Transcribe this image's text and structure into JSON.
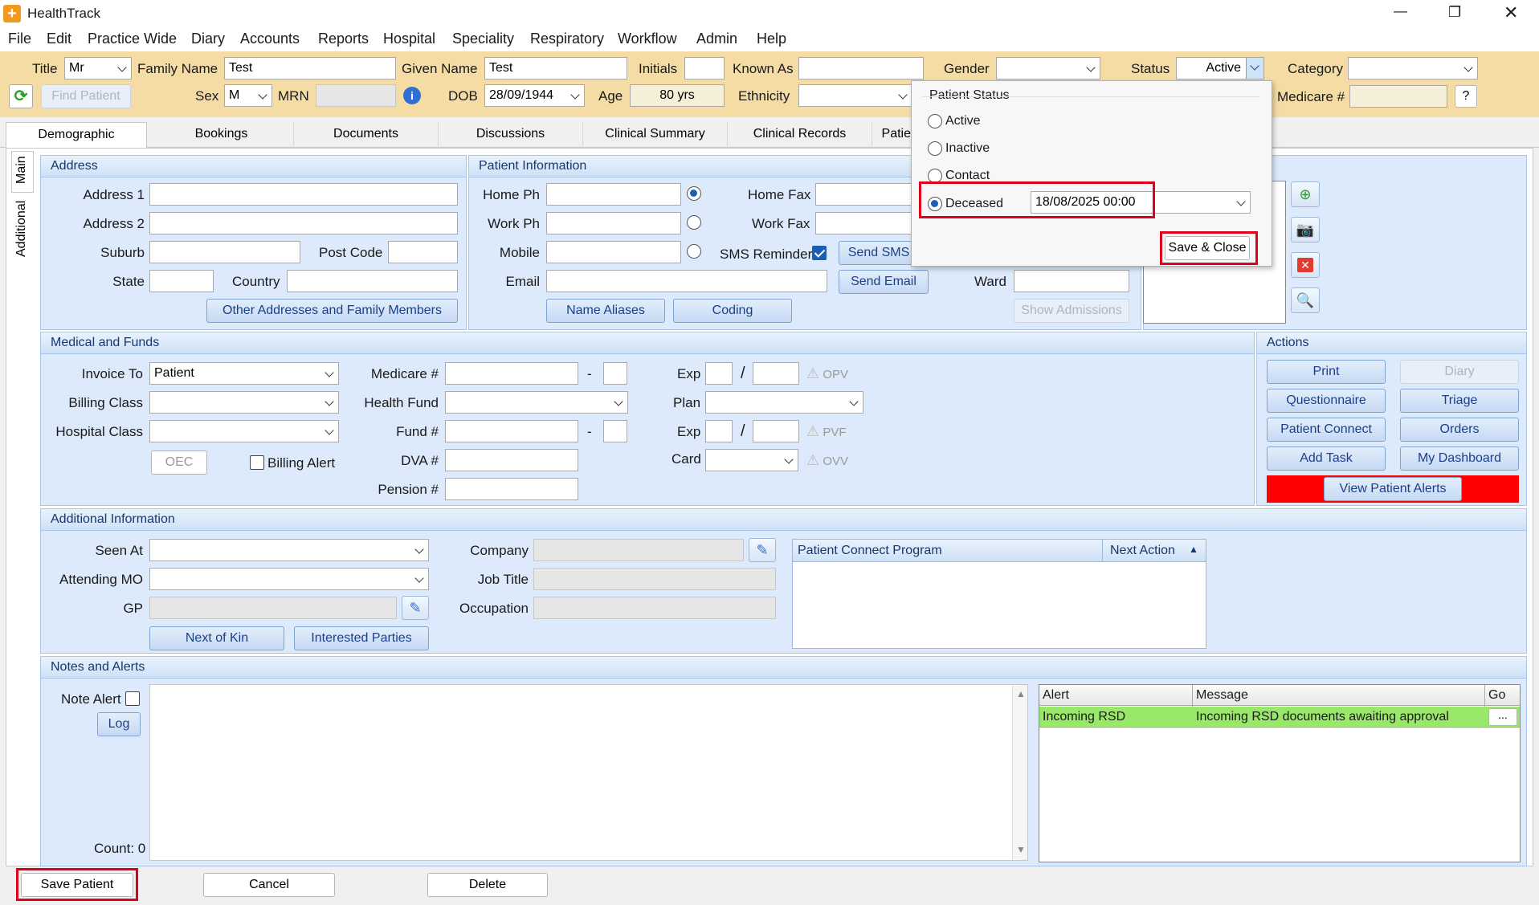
{
  "window": {
    "title": "HealthTrack",
    "minimize": "—",
    "restore": "❐",
    "close": "✕"
  },
  "menu": [
    "File",
    "Edit",
    "Practice Wide",
    "Diary",
    "Accounts",
    "Reports",
    "Hospital",
    "Speciality",
    "Respiratory",
    "Workflow",
    "Admin",
    "Help"
  ],
  "top": {
    "title_label": "Title",
    "title_value": "Mr",
    "family_label": "Family Name",
    "family_value": "Test",
    "given_label": "Given Name",
    "given_value": "Test",
    "initials_label": "Initials",
    "known_label": "Known As",
    "gender_label": "Gender",
    "status_label": "Status",
    "status_value": "Active",
    "category_label": "Category",
    "find_patient": "Find Patient",
    "sex_label": "Sex",
    "sex_value": "M",
    "mrn_label": "MRN",
    "dob_label": "DOB",
    "dob_value": "28/09/1944",
    "age_label": "Age",
    "age_value": "80 yrs",
    "ethnicity_label": "Ethnicity",
    "medicare_label": "Medicare #",
    "help": "?"
  },
  "tabs": [
    "Demographic",
    "Bookings",
    "Documents",
    "Discussions",
    "Clinical Summary",
    "Clinical Records",
    "Patie"
  ],
  "side_tabs": [
    "Main",
    "Additional"
  ],
  "address": {
    "header": "Address",
    "address1": "Address 1",
    "address2": "Address 2",
    "suburb": "Suburb",
    "postcode": "Post Code",
    "state": "State",
    "country": "Country",
    "other_btn": "Other Addresses and Family Members"
  },
  "patient_info": {
    "header": "Patient Information",
    "home_ph": "Home Ph",
    "work_ph": "Work Ph",
    "mobile": "Mobile",
    "email": "Email",
    "home_fax": "Home Fax",
    "work_fax": "Work Fax",
    "sms": "SMS Reminders",
    "send_sms": "Send SMS",
    "send_email": "Send Email",
    "ward": "Ward",
    "name_aliases": "Name Aliases",
    "coding": "Coding",
    "show_admissions": "Show Admissions"
  },
  "status_popup": {
    "header": "Patient Status",
    "options": [
      "Active",
      "Inactive",
      "Contact",
      "Deceased"
    ],
    "deceased_date": "18/08/2025  00:00",
    "save_close": "Save & Close"
  },
  "medical": {
    "header": "Medical and Funds",
    "invoice_to": "Invoice To",
    "invoice_value": "Patient",
    "billing_class": "Billing Class",
    "hospital_class": "Hospital Class",
    "oec": "OEC",
    "billing_alert": "Billing Alert",
    "medicare": "Medicare #",
    "dash": "-",
    "health_fund": "Health Fund",
    "fund": "Fund #",
    "dva": "DVA #",
    "pension": "Pension #",
    "exp": "Exp",
    "slash": "/",
    "plan": "Plan",
    "card": "Card",
    "opv": "OPV",
    "pvf": "PVF",
    "ovv": "OVV",
    "warn_glyph": "⚠"
  },
  "actions": {
    "header": "Actions",
    "buttons": [
      "Print",
      "Diary",
      "Questionnaire",
      "Triage",
      "Patient Connect",
      "Orders",
      "Add Task",
      "My Dashboard"
    ],
    "alerts_btn": "View Patient Alerts"
  },
  "additional": {
    "header": "Additional Information",
    "seen_at": "Seen At",
    "attending": "Attending MO",
    "gp": "GP",
    "company": "Company",
    "job_title": "Job Title",
    "occupation": "Occupation",
    "next_of_kin": "Next of Kin",
    "interested": "Interested Parties",
    "pc_cols": [
      "Patient Connect Program",
      "Next Action"
    ]
  },
  "notes": {
    "header": "Notes and Alerts",
    "note_alert": "Note Alert",
    "log": "Log",
    "count": "Count: 0",
    "alert_cols": [
      "Alert",
      "Message",
      "Go"
    ],
    "alert_rows": [
      {
        "alert": "Incoming RSD",
        "message": "Incoming RSD documents awaiting approval",
        "go": "..."
      }
    ]
  },
  "footer": {
    "save": "Save Patient",
    "cancel": "Cancel",
    "delete": "Delete"
  },
  "colors": {
    "alert_row": "#9ae86a",
    "alerts_btn_bg": "#ff0000",
    "highlight": "#e0001b"
  }
}
